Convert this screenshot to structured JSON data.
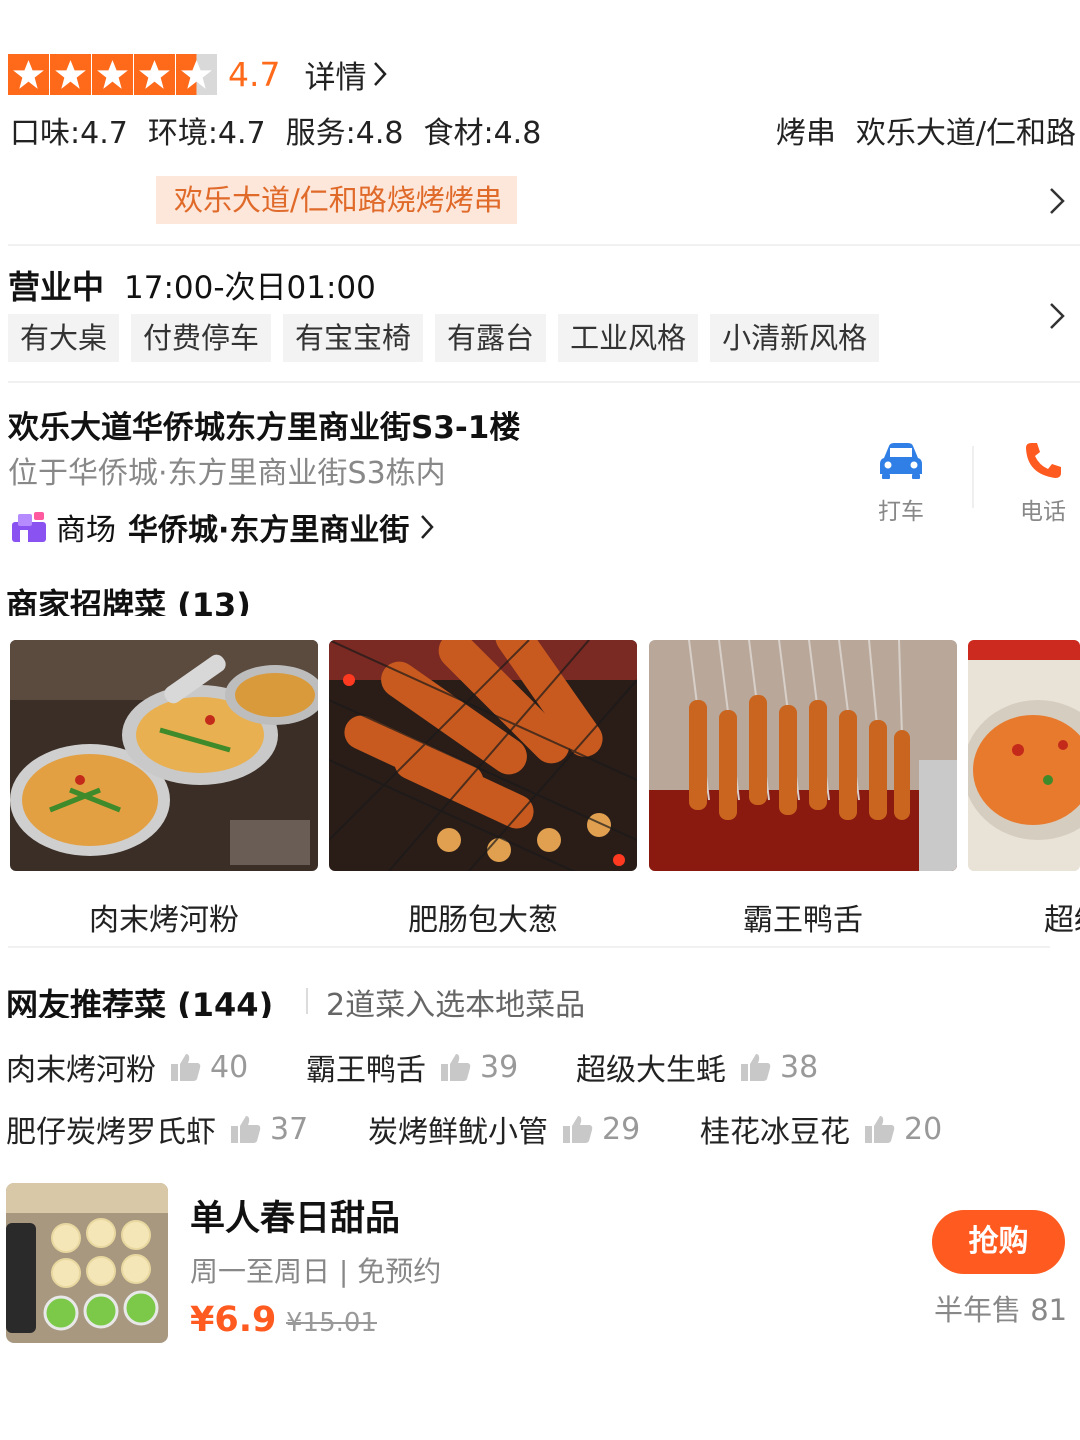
{
  "rating": {
    "stars": 4.5,
    "score": "4.7",
    "detail_label": "详情"
  },
  "sub_scores": [
    "口味:4.7",
    "环境:4.7",
    "服务:4.8",
    "食材:4.8"
  ],
  "category": "烤串",
  "area": "欢乐大道/仁和路",
  "ranking_tag": "欢乐大道/仁和路烧烤烤串",
  "hours": {
    "status": "营业中",
    "time": "17:00-次日01:00"
  },
  "facilities": [
    "有大桌",
    "付费停车",
    "有宝宝椅",
    "有露台",
    "工业风格",
    "小清新风格"
  ],
  "address": {
    "main": "欢乐大道华侨城东方里商业街S3-1楼",
    "sub": "位于华侨城·东方里商业街S3栋内",
    "mall_label": "商场",
    "mall_name": "华侨城·东方里商业街"
  },
  "actions": {
    "taxi": "打车",
    "phone": "电话"
  },
  "signature": {
    "title": "商家招牌菜 (13)",
    "dishes": [
      "肉末烤河粉",
      "肥肠包大葱",
      "霸王鸭舌",
      "超级"
    ]
  },
  "recommended": {
    "title": "网友推荐菜 (144)",
    "note": "2道菜入选本地菜品",
    "items": [
      {
        "name": "肉末烤河粉",
        "likes": "40"
      },
      {
        "name": "霸王鸭舌",
        "likes": "39"
      },
      {
        "name": "超级大生蚝",
        "likes": "38"
      },
      {
        "name": "肥仔炭烤罗氏虾",
        "likes": "37"
      },
      {
        "name": "炭烤鲜鱿小管",
        "likes": "29"
      },
      {
        "name": "桂花冰豆花",
        "likes": "20"
      }
    ]
  },
  "deal": {
    "title": "单人春日甜品",
    "sub": "周一至周日 | 免预约",
    "price": "¥6.9",
    "original_price": "¥15.01",
    "button": "抢购",
    "sold": "半年售 81"
  },
  "colors": {
    "accent": "#ff5a1f",
    "star": "#ff6a1a",
    "tag_bg": "#fde7da"
  }
}
